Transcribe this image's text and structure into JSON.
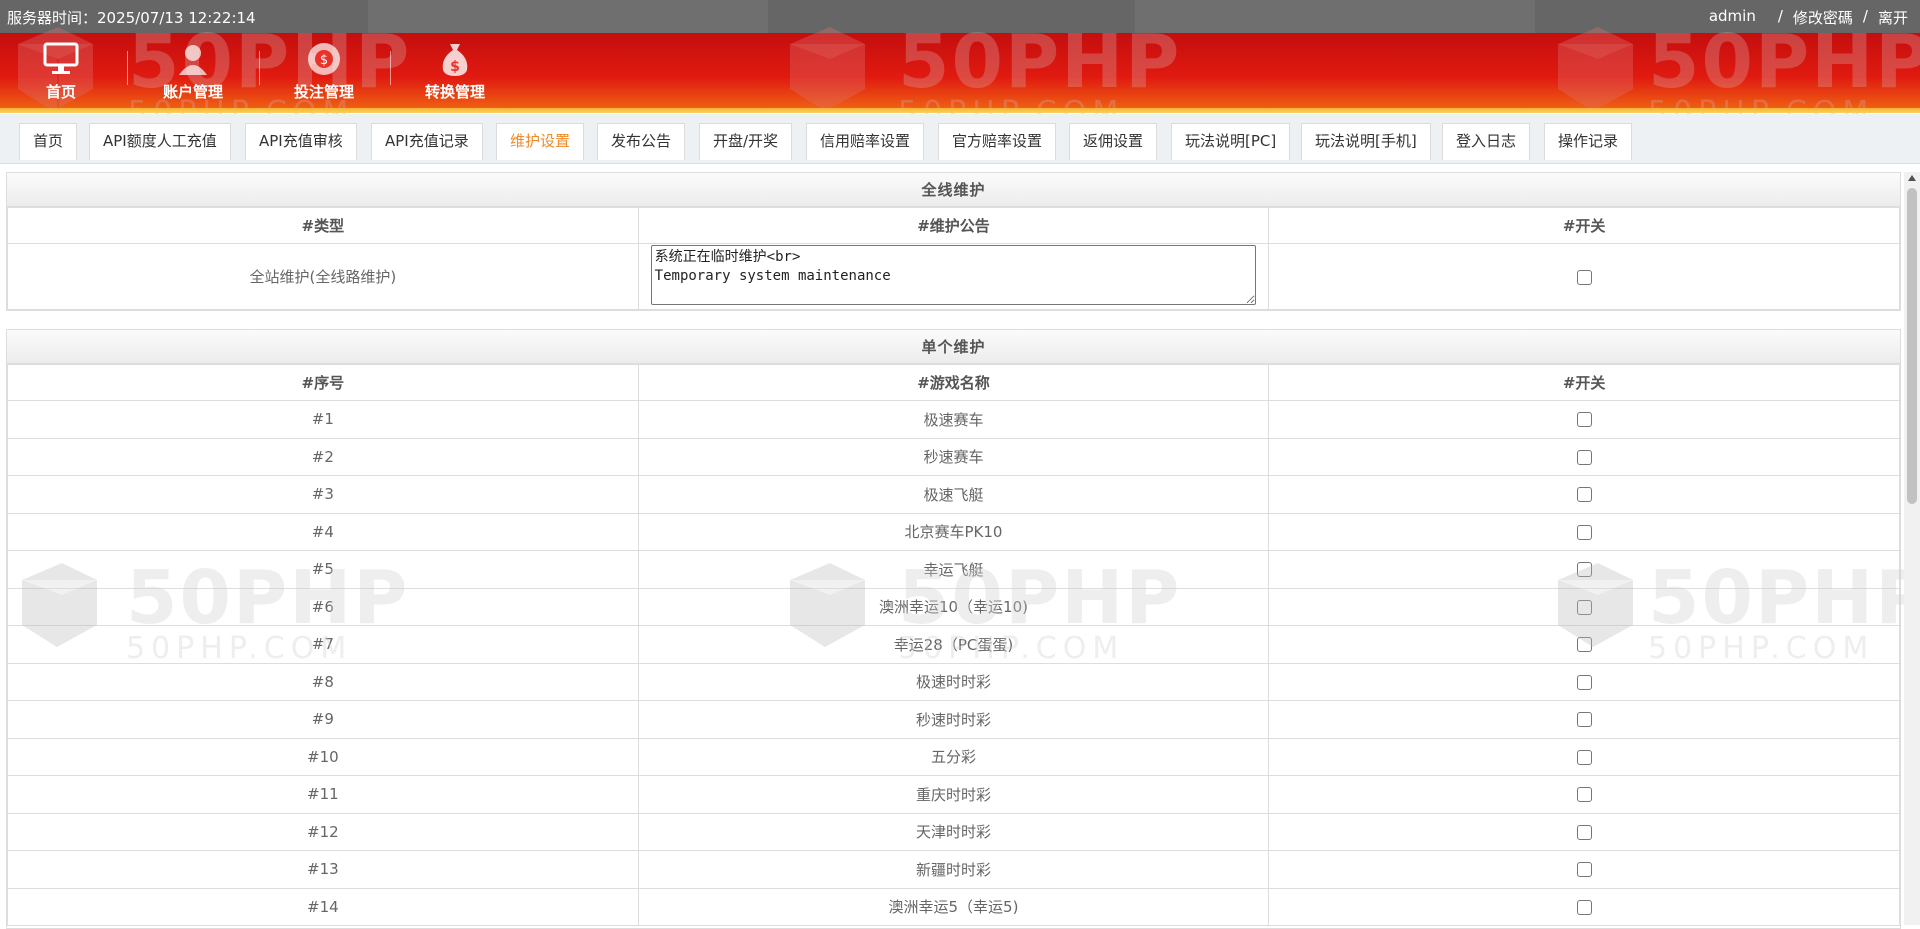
{
  "topbar": {
    "server_time": "服务器时间：2025/07/13 12:22:14",
    "user": "admin",
    "sep1": "/",
    "change_password": "修改密碼",
    "sep2": "/",
    "logout": "离开"
  },
  "nav": [
    {
      "label": "首页",
      "icon": "monitor-icon"
    },
    {
      "label": "账户管理",
      "icon": "user-icon"
    },
    {
      "label": "投注管理",
      "icon": "chip-icon"
    },
    {
      "label": "转换管理",
      "icon": "money-bag-icon"
    }
  ],
  "watermark": {
    "big": "50PHP",
    "small": "50PHP.COM"
  },
  "tabs": [
    {
      "label": "首页",
      "active": false
    },
    {
      "label": "API额度人工充值",
      "active": false
    },
    {
      "label": "API充值审核",
      "active": false
    },
    {
      "label": "API充值记录",
      "active": false
    },
    {
      "label": "维护设置",
      "active": true
    },
    {
      "label": "发布公告",
      "active": false
    },
    {
      "label": "开盘/开奖",
      "active": false
    },
    {
      "label": "信用赔率设置",
      "active": false
    },
    {
      "label": "官方赔率设置",
      "active": false
    },
    {
      "label": "返佣设置",
      "active": false
    },
    {
      "label": "玩法说明[PC]",
      "active": false
    },
    {
      "label": "玩法说明[手机]",
      "active": false
    },
    {
      "label": "登入日志",
      "active": false
    },
    {
      "label": "操作记录",
      "active": false
    }
  ],
  "full_maintenance": {
    "title": "全线维护",
    "headers": [
      "#类型",
      "#维护公告",
      "#开关"
    ],
    "type": "全站维护(全线路维护)",
    "notice": "系统正在临时维护<br>\nTemporary system maintenance",
    "enabled": false
  },
  "single_maintenance": {
    "title": "单个维护",
    "headers": [
      "#序号",
      "#游戏名称",
      "#开关"
    ],
    "rows": [
      {
        "no": "#1",
        "name": "极速赛车",
        "enabled": false
      },
      {
        "no": "#2",
        "name": "秒速赛车",
        "enabled": false
      },
      {
        "no": "#3",
        "name": "极速飞艇",
        "enabled": false
      },
      {
        "no": "#4",
        "name": "北京赛车PK10",
        "enabled": false
      },
      {
        "no": "#5",
        "name": "幸运飞艇",
        "enabled": false
      },
      {
        "no": "#6",
        "name": "澳洲幸运10（幸运10)",
        "enabled": false
      },
      {
        "no": "#7",
        "name": "幸运28（PC蛋蛋)",
        "enabled": false
      },
      {
        "no": "#8",
        "name": "极速时时彩",
        "enabled": false
      },
      {
        "no": "#9",
        "name": "秒速时时彩",
        "enabled": false
      },
      {
        "no": "#10",
        "name": "五分彩",
        "enabled": false
      },
      {
        "no": "#11",
        "name": "重庆时时彩",
        "enabled": false
      },
      {
        "no": "#12",
        "name": "天津时时彩",
        "enabled": false
      },
      {
        "no": "#13",
        "name": "新疆时时彩",
        "enabled": false
      },
      {
        "no": "#14",
        "name": "澳洲幸运5（幸运5)",
        "enabled": false
      }
    ]
  }
}
